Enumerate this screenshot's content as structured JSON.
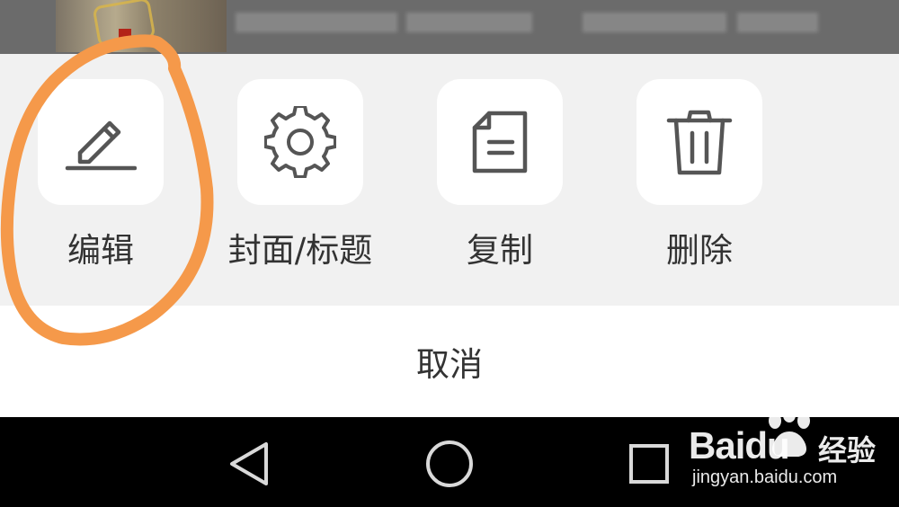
{
  "actions": [
    {
      "id": "edit",
      "label": "编辑",
      "icon": "pencil-icon"
    },
    {
      "id": "cover",
      "label": "封面/标题",
      "icon": "gear-icon"
    },
    {
      "id": "copy",
      "label": "复制",
      "icon": "document-icon"
    },
    {
      "id": "delete",
      "label": "删除",
      "icon": "trash-icon"
    }
  ],
  "cancel_label": "取消",
  "nav": {
    "back": "triangle-back-icon",
    "home": "circle-home-icon",
    "recents": "square-recents-icon"
  },
  "watermark": {
    "brand": "Baidu",
    "product": "经验",
    "url": "jingyan.baidu.com"
  },
  "annotation_color": "#f5994a",
  "colors": {
    "sheet_bg": "#f1f1f1",
    "tile_bg": "#ffffff",
    "icon": "#555555",
    "text": "#333333"
  }
}
